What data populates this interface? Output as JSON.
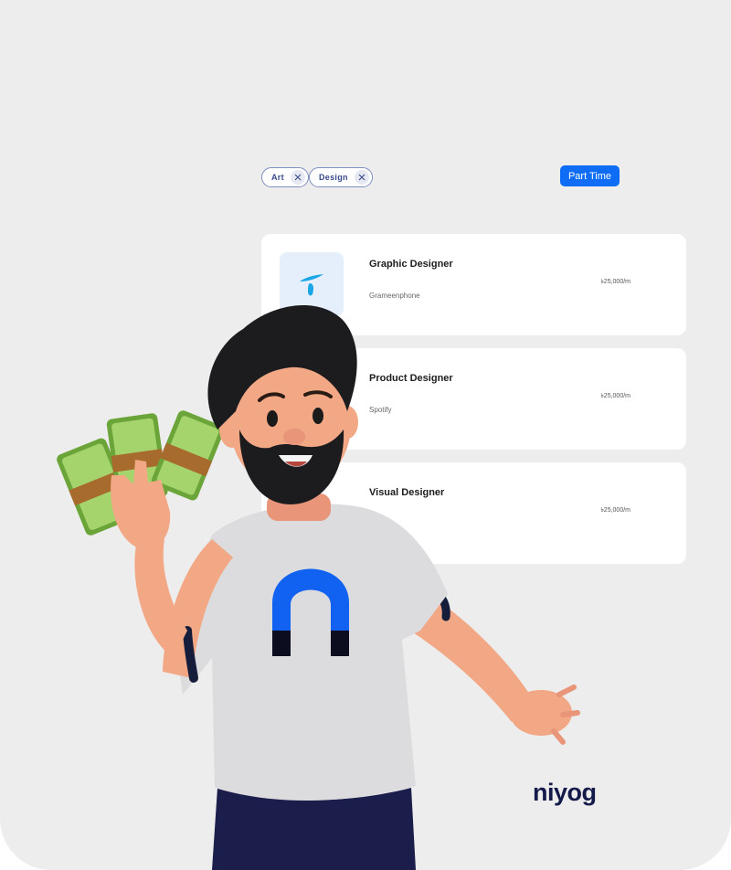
{
  "filters": {
    "chips": [
      {
        "label": "Art"
      },
      {
        "label": "Design"
      }
    ],
    "job_type": "Part Time"
  },
  "jobs": [
    {
      "title": "Graphic Designer",
      "company": "Grameenphone",
      "salary": "৳25,000/m",
      "logo_icon": "telenor-icon"
    },
    {
      "title": "Product Designer",
      "company": "Spotify",
      "salary": "৳25,000/m"
    },
    {
      "title": "Visual Designer",
      "company": "",
      "salary": "৳25,000/m"
    }
  ],
  "brand": {
    "name": "niyog",
    "colors": {
      "navy": "#141a4a",
      "blue": "#0f6cf5"
    }
  },
  "colors": {
    "accent": "#0f6cf5",
    "background": "#ededed",
    "card": "#ffffff"
  }
}
